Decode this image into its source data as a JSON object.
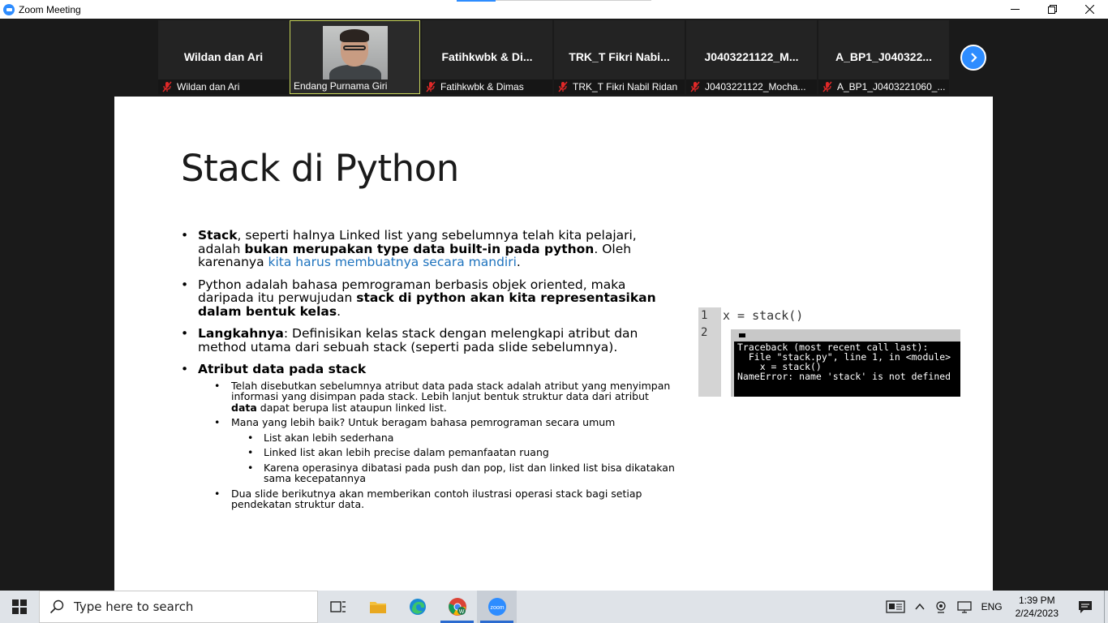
{
  "window": {
    "title": "Zoom Meeting"
  },
  "participants": [
    {
      "big_name": "Wildan dan Ari",
      "name": "Wildan dan Ari",
      "muted": true
    },
    {
      "big_name": "",
      "name": "Endang Purnama Giri",
      "muted": false,
      "video": true
    },
    {
      "big_name": "Fatihkwbk  & Di...",
      "name": "Fatihkwbk & Dimas",
      "muted": true
    },
    {
      "big_name": "TRK_T Fikri Nabi...",
      "name": "TRK_T Fikri Nabil Ridan",
      "muted": true
    },
    {
      "big_name": "J0403221122_M...",
      "name": "J0403221122_Mocha...",
      "muted": true
    },
    {
      "big_name": "A_BP1_J040322...",
      "name": "A_BP1_J0403221060_...",
      "muted": true
    }
  ],
  "slide": {
    "title": "Stack di Python",
    "bullet1": {
      "t1": "Stack",
      "t2": ", seperti halnya Linked list yang sebelumnya telah kita pelajari, adalah ",
      "t3": "bukan merupakan type data built-in pada python",
      "t4": ". Oleh karenanya ",
      "t5": "kita harus membuatnya secara mandiri",
      "t6": "."
    },
    "bullet2": {
      "t1": "Python adalah bahasa pemrograman berbasis objek oriented, maka daripada itu perwujudan ",
      "t2": "stack di python akan kita representasikan dalam bentuk kelas",
      "t3": "."
    },
    "bullet3": {
      "t1": "Langkahnya",
      "t2": ": Definisikan kelas stack dengan melengkapi atribut dan method utama dari sebuah stack (seperti pada slide sebelumnya)."
    },
    "bullet4": {
      "t1": "Atribut data pada stack"
    },
    "sub1": {
      "t1": "Telah disebutkan sebelumnya atribut data pada stack adalah atribut yang menyimpan informasi yang disimpan pada stack. Lebih lanjut bentuk struktur data dari atribut ",
      "t2": "data",
      "t3": " dapat berupa list ataupun linked list."
    },
    "sub2": "Mana yang lebih baik? Untuk beragam bahasa pemrograman secara umum",
    "subsub1": "List akan lebih sederhana",
    "subsub2": "Linked list akan lebih precise dalam pemanfaatan ruang",
    "subsub3": "Karena operasinya dibatasi pada push dan pop, list dan linked list bisa dikatakan sama kecepatannya",
    "sub3": "Dua slide berikutnya akan memberikan contoh ilustrasi operasi stack bagi setiap pendekatan struktur data."
  },
  "code": {
    "line_numbers": [
      "1",
      "2"
    ],
    "line1": "x = stack()",
    "console_output": "Traceback (most recent call last):\n  File \"stack.py\", line 1, in <module>\n    x = stack()\nNameError: name 'stack' is not defined"
  },
  "taskbar": {
    "search_placeholder": "Type here to search",
    "language": "ENG",
    "time": "1:39 PM",
    "date": "2/24/2023",
    "apps": [
      "task-view",
      "file-explorer",
      "edge",
      "chrome",
      "zoom"
    ]
  },
  "colors": {
    "zoom_blue": "#2d8cff",
    "link_blue": "#1e73be",
    "active_border": "#c8d65b",
    "mute_red": "#e02828"
  }
}
